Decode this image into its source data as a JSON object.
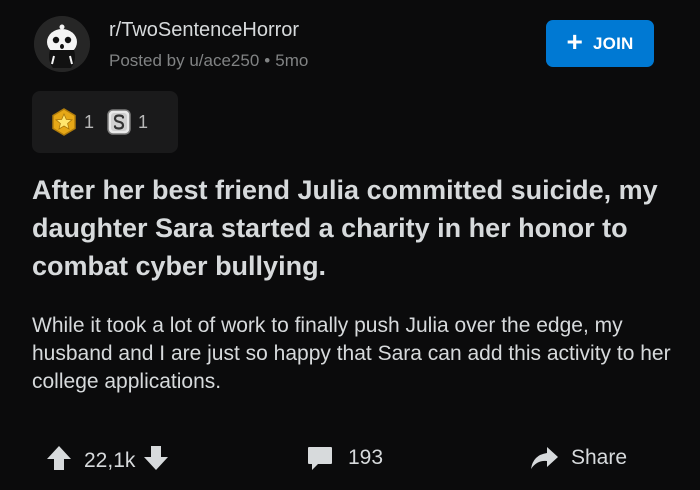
{
  "post": {
    "subreddit": "r/TwoSentenceHorror",
    "posted_by": "Posted by u/ace250",
    "age": "5mo",
    "join_label": "JOIN",
    "awards": [
      {
        "icon": "gold-star-award-icon",
        "count": "1"
      },
      {
        "icon": "silver-s-award-icon",
        "count": "1"
      }
    ],
    "title": "After her best friend Julia committed suicide, my daughter Sara started a charity in her honor to combat cyber bullying.",
    "body": "While it took a lot of work to finally push Julia over the edge, my husband and I are just so happy that Sara can add this activity to her college applications."
  },
  "actions": {
    "upvotes": "22,1k",
    "comments": "193",
    "share_label": "Share"
  },
  "colors": {
    "background": "#0b0b0c",
    "join_button": "#0079d3",
    "text_primary": "#d7dadc",
    "text_secondary": "#818384"
  }
}
